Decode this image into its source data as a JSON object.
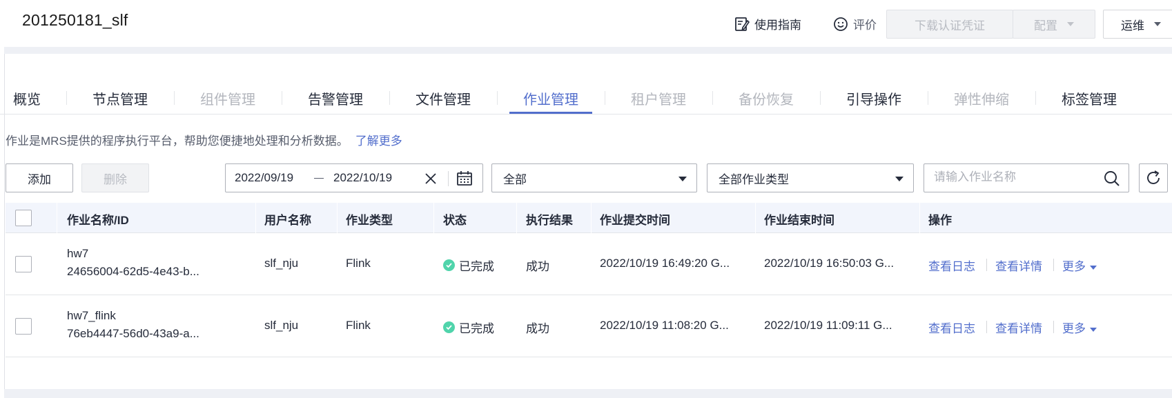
{
  "header": {
    "cluster_name": "201250181_slf",
    "guide_label": "使用指南",
    "rate_label": "评价",
    "download_cert_label": "下载认证凭证",
    "config_label": "配置",
    "ops_label": "运维"
  },
  "tabs": [
    {
      "label": "概览",
      "state": "normal"
    },
    {
      "label": "节点管理",
      "state": "normal"
    },
    {
      "label": "组件管理",
      "state": "disabled"
    },
    {
      "label": "告警管理",
      "state": "normal"
    },
    {
      "label": "文件管理",
      "state": "normal"
    },
    {
      "label": "作业管理",
      "state": "active"
    },
    {
      "label": "租户管理",
      "state": "disabled"
    },
    {
      "label": "备份恢复",
      "state": "disabled"
    },
    {
      "label": "引导操作",
      "state": "normal"
    },
    {
      "label": "弹性伸缩",
      "state": "disabled"
    },
    {
      "label": "标签管理",
      "state": "normal"
    }
  ],
  "description": {
    "text": "作业是MRS提供的程序执行平台，帮助您便捷地处理和分析数据。",
    "link": "了解更多"
  },
  "toolbar": {
    "add_label": "添加",
    "delete_label": "删除",
    "date_start": "2022/09/19",
    "date_end": "2022/10/19",
    "status_filter": "全部",
    "type_filter": "全部作业类型",
    "search_placeholder": "请输入作业名称"
  },
  "table": {
    "columns": [
      "作业名称/ID",
      "用户名称",
      "作业类型",
      "状态",
      "执行结果",
      "作业提交时间",
      "作业结束时间",
      "操作"
    ],
    "rows": [
      {
        "name": "hw7",
        "id": "24656004-62d5-4e43-b...",
        "user": "slf_nju",
        "type": "Flink",
        "status": "已完成",
        "result": "成功",
        "submit_time": "2022/10/19 16:49:20 G...",
        "end_time": "2022/10/19 16:50:03 G...",
        "ops": [
          "查看日志",
          "查看详情",
          "更多"
        ]
      },
      {
        "name": "hw7_flink",
        "id": "76eb4447-56d0-43a9-a...",
        "user": "slf_nju",
        "type": "Flink",
        "status": "已完成",
        "result": "成功",
        "submit_time": "2022/10/19 11:08:20 G...",
        "end_time": "2022/10/19 11:09:11 G...",
        "ops": [
          "查看日志",
          "查看详情",
          "更多"
        ]
      }
    ]
  },
  "colors": {
    "accent": "#526ecc",
    "success": "#50d4ab",
    "disabled_text": "#b3b6bd"
  }
}
